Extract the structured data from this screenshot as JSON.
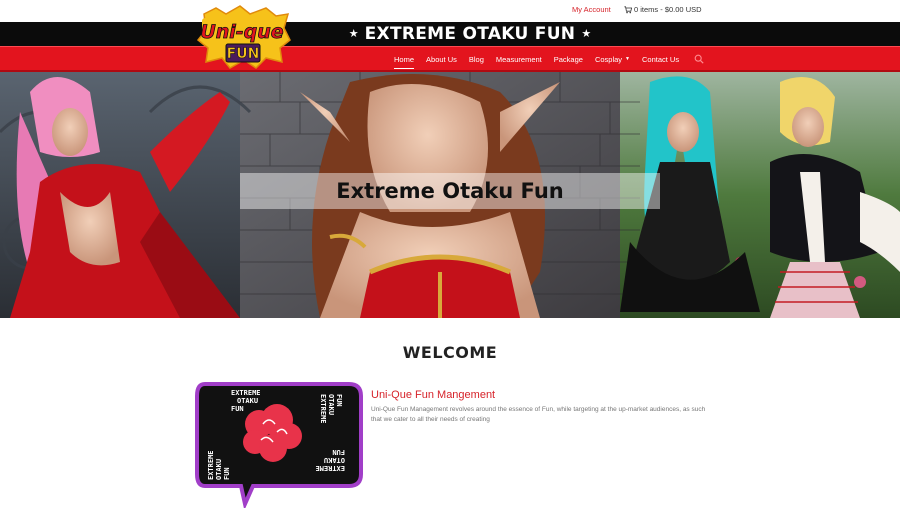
{
  "header": {
    "account_label": "My Account",
    "cart_label": "0 items - $0.00 USD",
    "site_title": "EXTREME OTAKU FUN",
    "logo": {
      "line1": "Uni-que",
      "line2": "FUN"
    }
  },
  "nav": {
    "items": [
      {
        "label": "Home"
      },
      {
        "label": "About Us"
      },
      {
        "label": "Blog"
      },
      {
        "label": "Measurement"
      },
      {
        "label": "Package"
      },
      {
        "label": "Cosplay"
      },
      {
        "label": "Contact Us"
      }
    ]
  },
  "hero": {
    "caption": "Extreme Otaku Fun"
  },
  "welcome": {
    "heading": "WELCOME",
    "badge_text": {
      "top": [
        "EXTREME",
        "OTAKU",
        "FUN"
      ],
      "right": [
        "EXTREME",
        "OTAKU",
        "FUN"
      ],
      "left": [
        "EXTREME",
        "OTAKU",
        "FUN"
      ],
      "bottom": [
        "EXTREME",
        "OTAKU",
        "FUN"
      ]
    },
    "section_title": "Uni-Que Fun Mangement",
    "section_text": "Uni-Que Fun Management revolves around the essence of Fun, while targeting at the up-market audiences, as such that we cater to all their needs of creating"
  },
  "colors": {
    "brand_red": "#e3141e",
    "accent_red": "#d6232a",
    "band_black": "#0b0b0b",
    "badge_purple": "#a13ec8"
  }
}
